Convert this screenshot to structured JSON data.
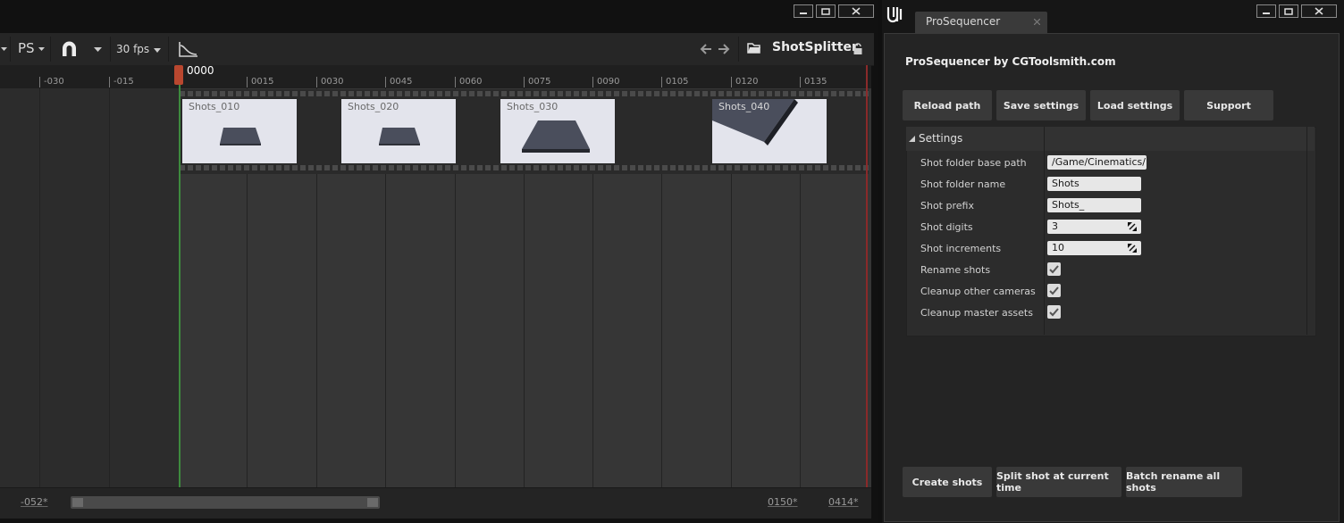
{
  "sequencer": {
    "toolbar": {
      "snap_label": "PS",
      "fps_label": "30 fps",
      "sequence_name": "ShotSplitter"
    },
    "ruler": {
      "current_frame": "0000",
      "ticks": [
        "-030",
        "-015",
        "0015",
        "0030",
        "0045",
        "0060",
        "0075",
        "0090",
        "0105",
        "0120",
        "0135"
      ]
    },
    "shots": [
      "Shots_010",
      "Shots_020",
      "Shots_030",
      "Shots_040"
    ],
    "bottom": {
      "view_start": "-052*",
      "view_end": "0150*",
      "playback_end": "0414*"
    }
  },
  "prosequencer": {
    "tab_title": "ProSequencer",
    "header": "ProSequencer by CGToolsmith.com",
    "top_buttons": [
      "Reload path",
      "Save settings",
      "Load settings",
      "Support"
    ],
    "settings": {
      "title": "Settings",
      "rows": [
        {
          "label": "Shot folder base path",
          "value": "/Game/Cinematics/"
        },
        {
          "label": "Shot folder name",
          "value": "Shots"
        },
        {
          "label": "Shot prefix",
          "value": "Shots_"
        },
        {
          "label": "Shot digits",
          "value": "3"
        },
        {
          "label": "Shot increments",
          "value": "10"
        },
        {
          "label": "Rename shots",
          "checked": true
        },
        {
          "label": "Cleanup other cameras",
          "checked": true
        },
        {
          "label": "Cleanup master assets",
          "checked": true
        }
      ]
    },
    "bottom_buttons": [
      "Create shots",
      "Split shot at current time",
      "Batch rename all shots"
    ]
  }
}
